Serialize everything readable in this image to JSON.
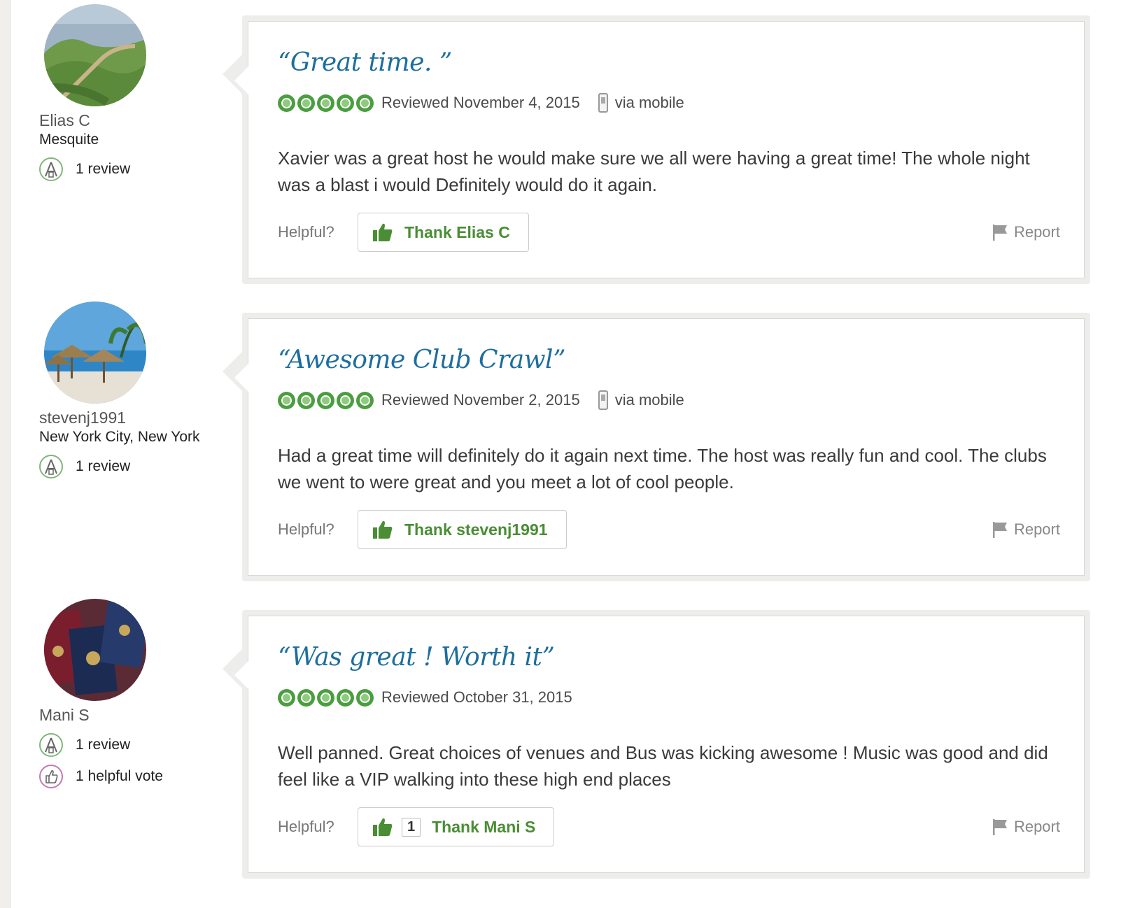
{
  "reviews": [
    {
      "username": "Elias C",
      "location": "Mesquite",
      "stats": [
        {
          "icon": "reviewer-badge-icon",
          "text": "1 review"
        }
      ],
      "avatar_icon": "great-wall-landscape-avatar",
      "title": "“Great time. ”",
      "rating": 5,
      "reviewed": "Reviewed November 4, 2015",
      "via": "via mobile",
      "text": "Xavier was a great host he would make sure we all were having a great time! The whole night was a blast i would Definitely would do it again.",
      "helpful": "Helpful?",
      "thank_count": "",
      "thank_label": "Thank Elias C",
      "report": "Report"
    },
    {
      "username": "stevenj1991",
      "location": "New York City, New York",
      "stats": [
        {
          "icon": "reviewer-badge-icon",
          "text": "1 review"
        }
      ],
      "avatar_icon": "beach-umbrellas-avatar",
      "title": "“Awesome Club Crawl”",
      "rating": 5,
      "reviewed": "Reviewed November 2, 2015",
      "via": "via mobile",
      "text": "Had a great time will definitely do it again next time. The host was really fun and cool. The clubs we went to were great and you meet a lot of cool people.",
      "helpful": "Helpful?",
      "thank_count": "",
      "thank_label": "Thank stevenj1991",
      "report": "Report"
    },
    {
      "username": "Mani S",
      "location": "",
      "stats": [
        {
          "icon": "reviewer-badge-icon",
          "text": "1 review"
        },
        {
          "icon": "helpful-vote-icon",
          "text": "1 helpful vote"
        }
      ],
      "avatar_icon": "passports-avatar",
      "title": "“Was great ! Worth it”",
      "rating": 5,
      "reviewed": "Reviewed October 31, 2015",
      "via": "",
      "text": "Well panned. Great choices of venues and Bus was kicking awesome ! Music was good and did feel like a VIP walking into these high end places",
      "helpful": "Helpful?",
      "thank_count": "1",
      "thank_label": "Thank Mani S",
      "report": "Report"
    }
  ],
  "colors": {
    "title_blue": "#1d6e9e",
    "bubble_green": "#4a9e3f",
    "thank_green": "#4a8d34"
  }
}
